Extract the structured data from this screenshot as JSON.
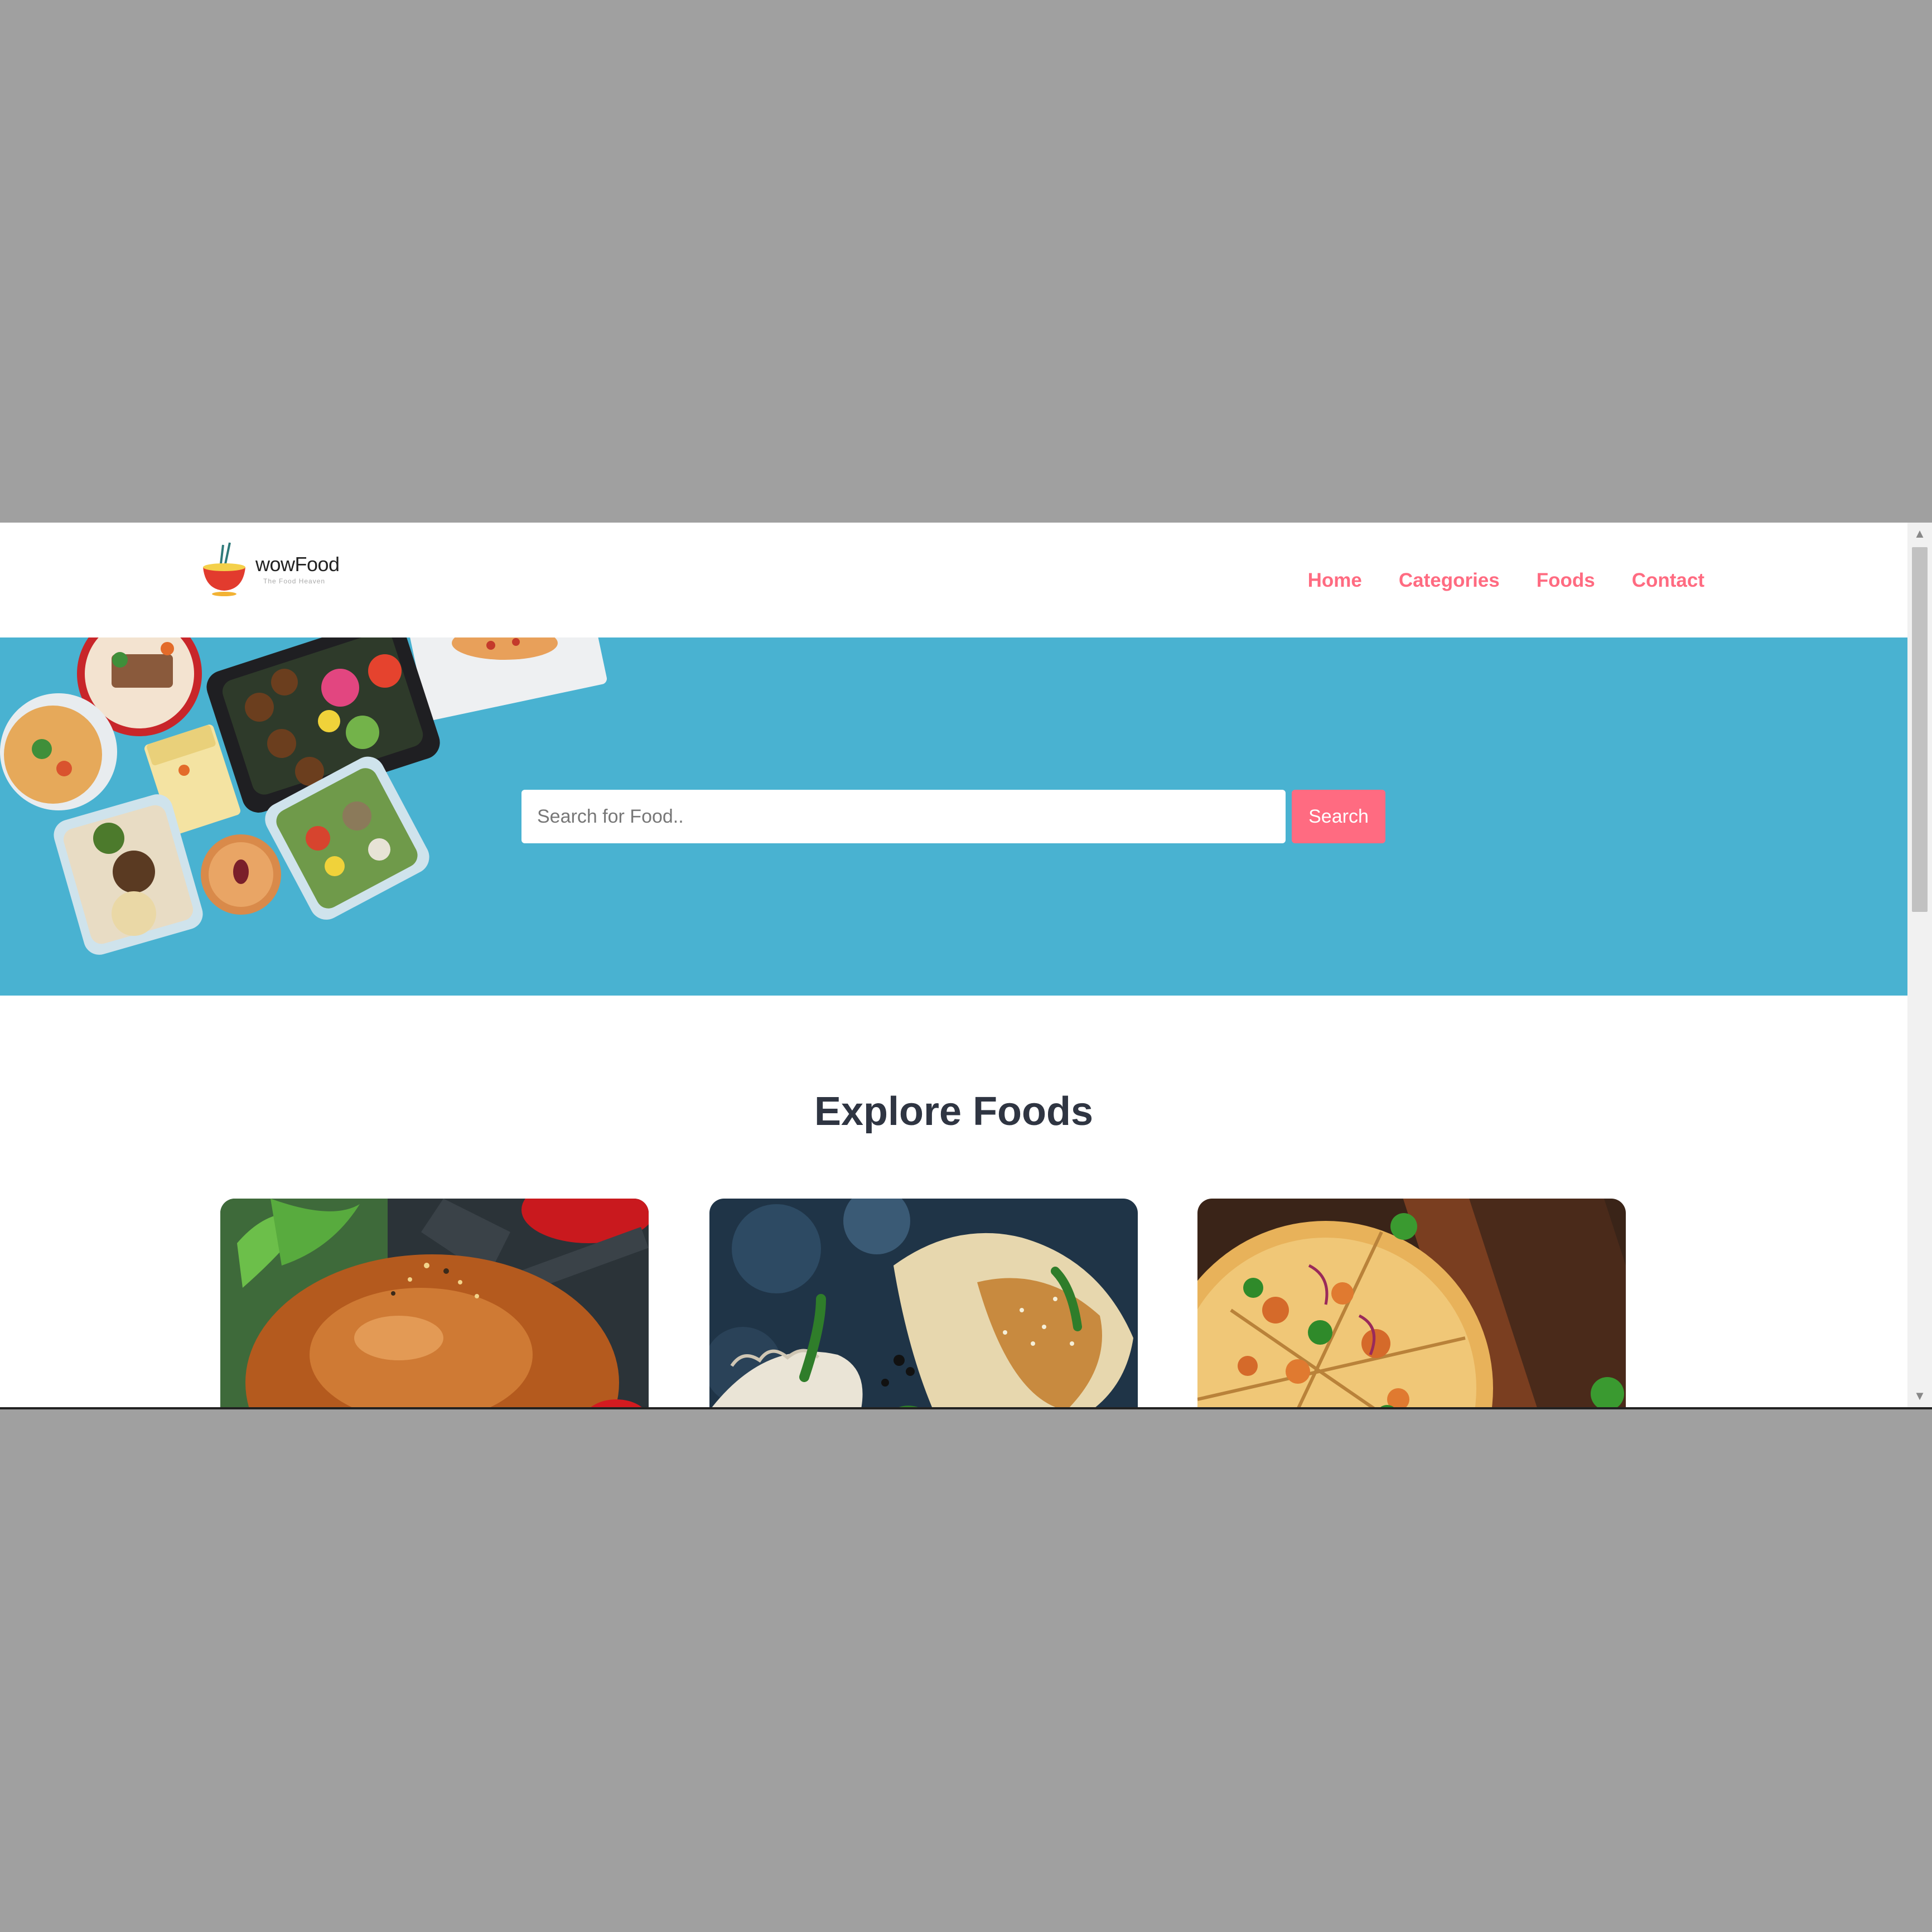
{
  "brand": {
    "name": "wowFood",
    "tagline": "The Food Heaven"
  },
  "nav": {
    "items": [
      {
        "label": "Home"
      },
      {
        "label": "Categories"
      },
      {
        "label": "Foods"
      },
      {
        "label": "Contact"
      }
    ]
  },
  "hero": {
    "search_placeholder": "Search for Food..",
    "search_button": "Search"
  },
  "explore": {
    "title": "Explore Foods",
    "cards": [
      {
        "icon": "burger-image"
      },
      {
        "icon": "dumplings-image"
      },
      {
        "icon": "pizza-image"
      }
    ]
  },
  "colors": {
    "accent": "#ff6b81",
    "hero_bg": "#49b2d1",
    "title": "#2f3542"
  }
}
